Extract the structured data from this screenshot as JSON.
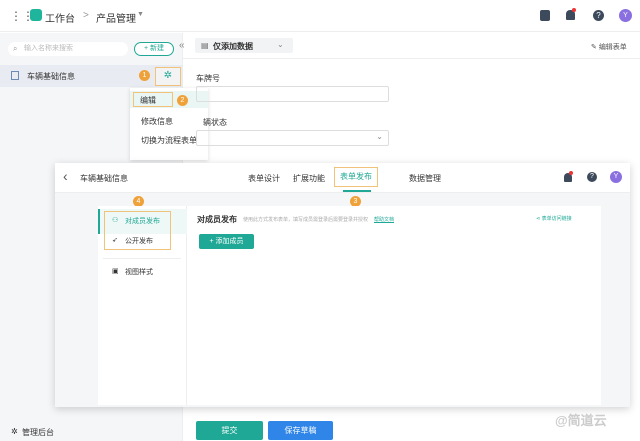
{
  "topbar": {
    "app": "工作台",
    "separator": ">",
    "product": "产品管理"
  },
  "sidebar": {
    "search_placeholder": "输入名称来搜索",
    "new_label": "+ 新建",
    "collapse": "«",
    "item": "车辆基础信息",
    "admin": "管理后台"
  },
  "menu": {
    "items": [
      "编辑",
      "修改信息",
      "切换为流程表单"
    ]
  },
  "main": {
    "view_select": "仅添加数据",
    "edit_form": "编辑表单",
    "field1": "车牌号",
    "field2": "辆状态",
    "submit": "提交",
    "save_draft": "保存草稿"
  },
  "overlay": {
    "back_title": "车辆基础信息",
    "tabs": [
      "表单设计",
      "扩展功能",
      "表单发布",
      "数据管理"
    ],
    "avatar": "Y",
    "side_items": [
      "对成员发布",
      "公开发布",
      "视图样式"
    ],
    "title": "对成员发布",
    "desc": "使用此方式发布表单，填写成员需登录后需要登录并授权",
    "help": "帮助文档",
    "share_link": "表单访问链接",
    "add_member": "+ 添加成员"
  },
  "badges": [
    "1",
    "2",
    "3",
    "4"
  ],
  "watermark": "@简道云",
  "colors": {
    "accent": "#1fa896",
    "blue": "#2f86e8",
    "badge": "#f0a23a"
  }
}
